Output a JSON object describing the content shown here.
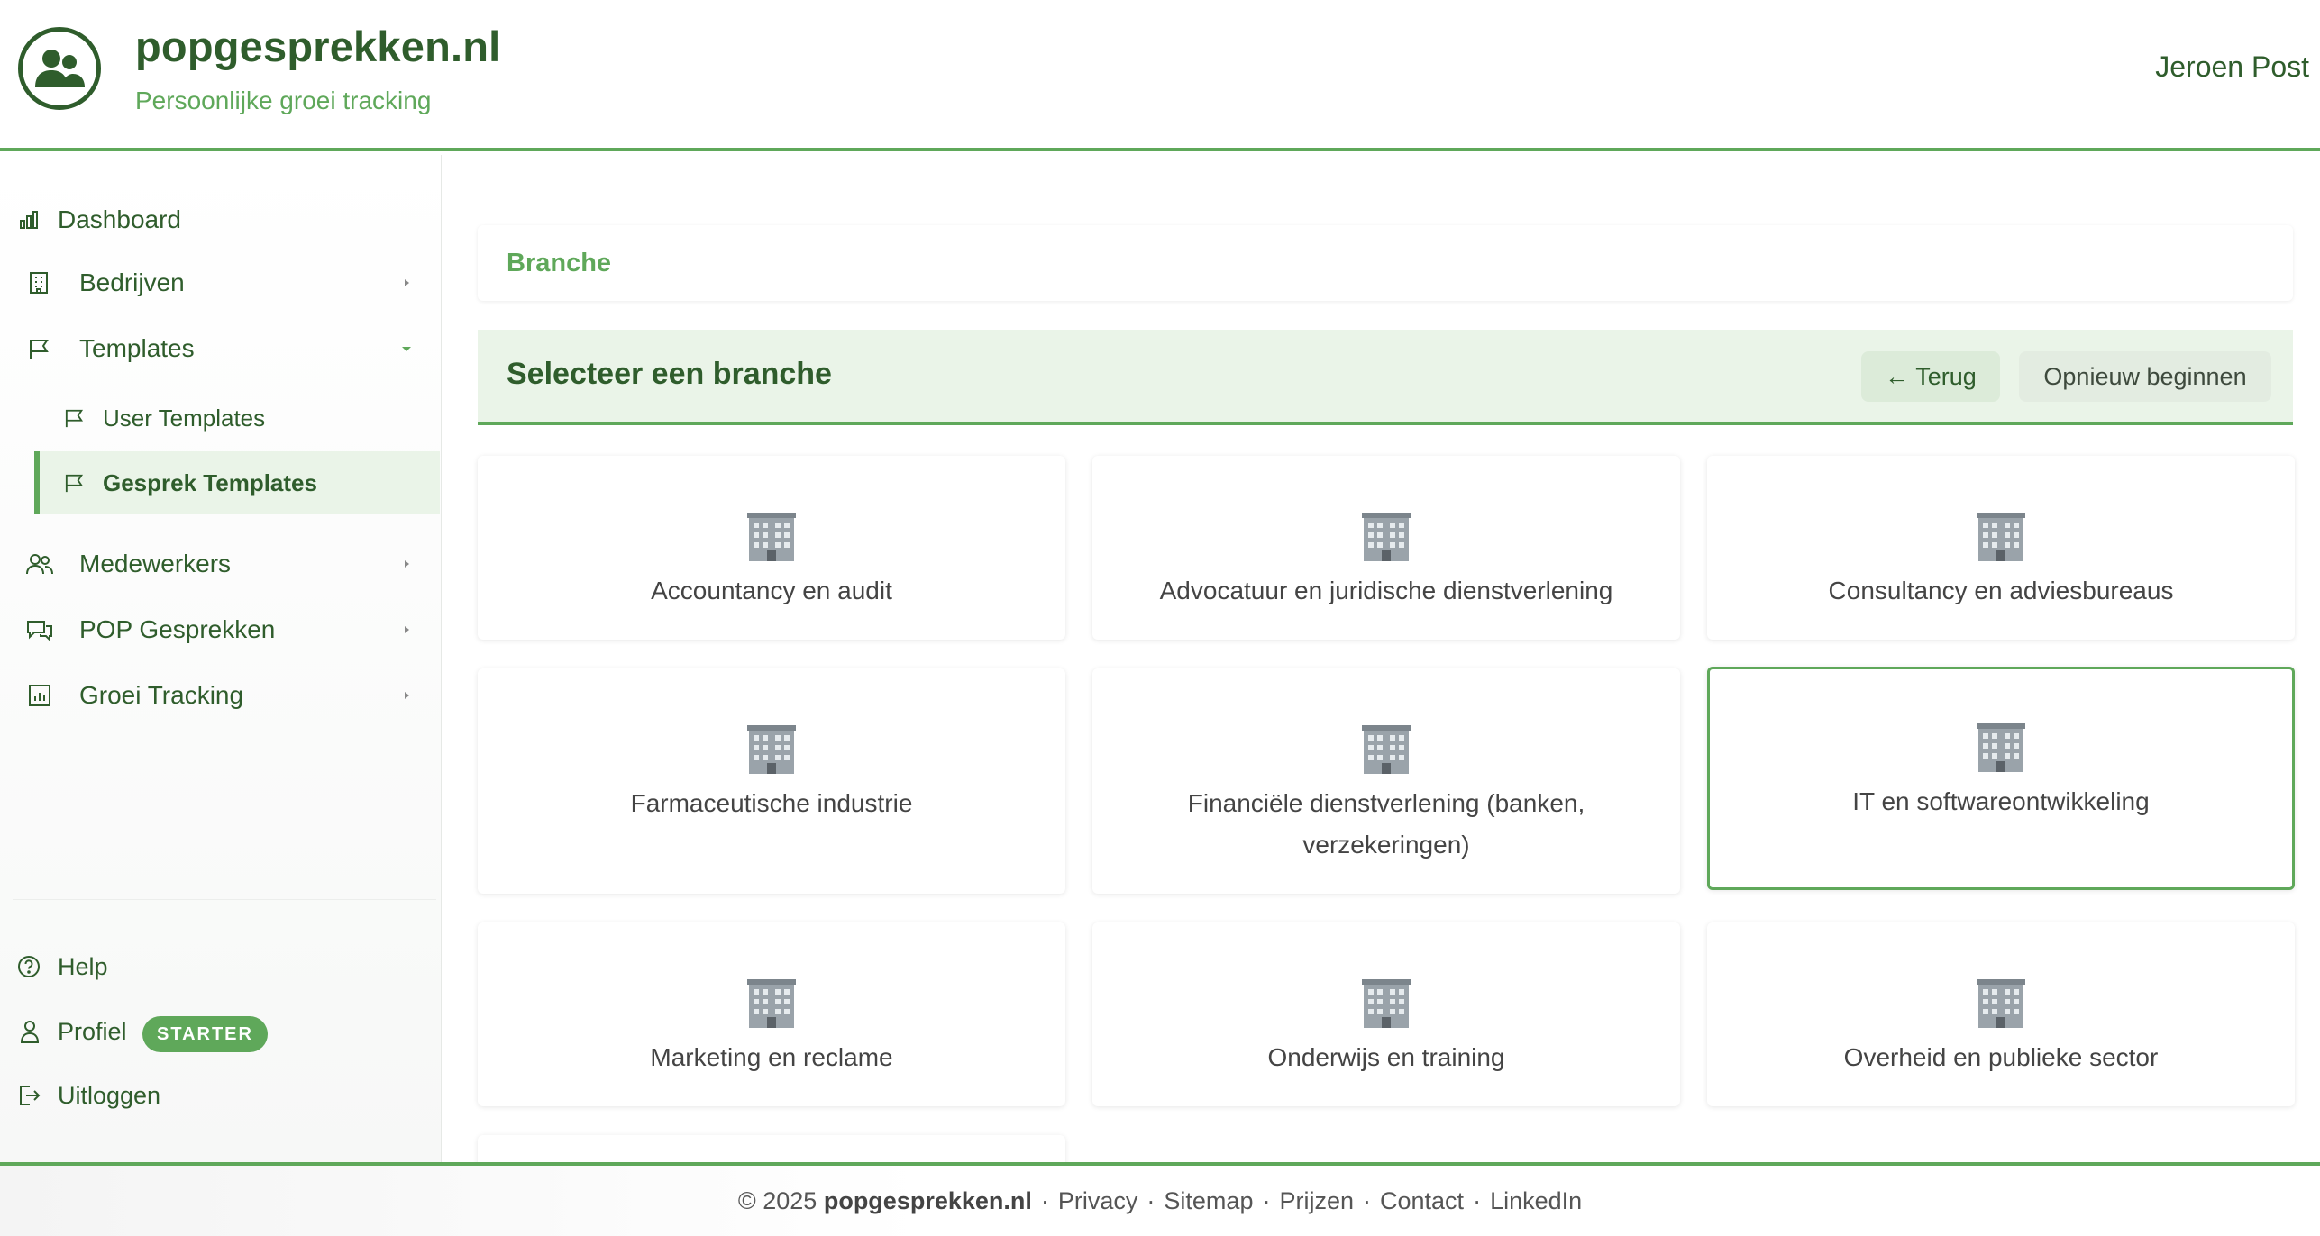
{
  "header": {
    "brand_title": "popgesprekken.nl",
    "brand_subtitle": "Persoonlijke groei tracking",
    "user_name": "Jeroen Post"
  },
  "sidebar": {
    "items": [
      {
        "label": "Dashboard",
        "icon": "bar-chart-icon"
      },
      {
        "label": "Bedrijven",
        "icon": "building-icon",
        "has_submenu": true
      },
      {
        "label": "Templates",
        "icon": "flag-icon",
        "expanded": true
      },
      {
        "label": "User Templates",
        "icon": "flag-icon"
      },
      {
        "label": "Gesprek Templates",
        "icon": "flag-icon",
        "active": true
      },
      {
        "label": "Medewerkers",
        "icon": "users-icon",
        "has_submenu": true
      },
      {
        "label": "POP Gesprekken",
        "icon": "chat-icon",
        "has_submenu": true
      },
      {
        "label": "Groei Tracking",
        "icon": "chart-icon",
        "has_submenu": true
      }
    ],
    "bottom": [
      {
        "label": "Help",
        "icon": "help-icon"
      },
      {
        "label": "Profiel",
        "icon": "user-icon",
        "badge": "STARTER"
      },
      {
        "label": "Uitloggen",
        "icon": "logout-icon"
      }
    ]
  },
  "main": {
    "breadcrumb": "Branche",
    "step_title": "Selecteer een branche",
    "back_button": "← Terug",
    "restart_button": "Opnieuw beginnen",
    "branches": [
      {
        "name": "Accountancy en audit",
        "selected": false
      },
      {
        "name": "Advocatuur en juridische dienstverlening",
        "selected": false
      },
      {
        "name": "Consultancy en adviesbureaus",
        "selected": false
      },
      {
        "name": "Farmaceutische industrie",
        "selected": false
      },
      {
        "name": "Financiële dienstverlening (banken, verzekeringen)",
        "selected": false
      },
      {
        "name": "IT en softwareontwikkeling",
        "selected": true
      },
      {
        "name": "Marketing en reclame",
        "selected": false
      },
      {
        "name": "Onderwijs en training",
        "selected": false
      },
      {
        "name": "Overheid en publieke sector",
        "selected": false
      }
    ]
  },
  "footer": {
    "copyright": "© 2025",
    "brand": "popgesprekken.nl",
    "links": [
      "Privacy",
      "Sitemap",
      "Prijzen",
      "Contact",
      "LinkedIn"
    ]
  },
  "colors": {
    "brand_dark": "#2f5d2c",
    "brand_accent": "#5fa85a",
    "active_bg": "#eaf4e8"
  }
}
